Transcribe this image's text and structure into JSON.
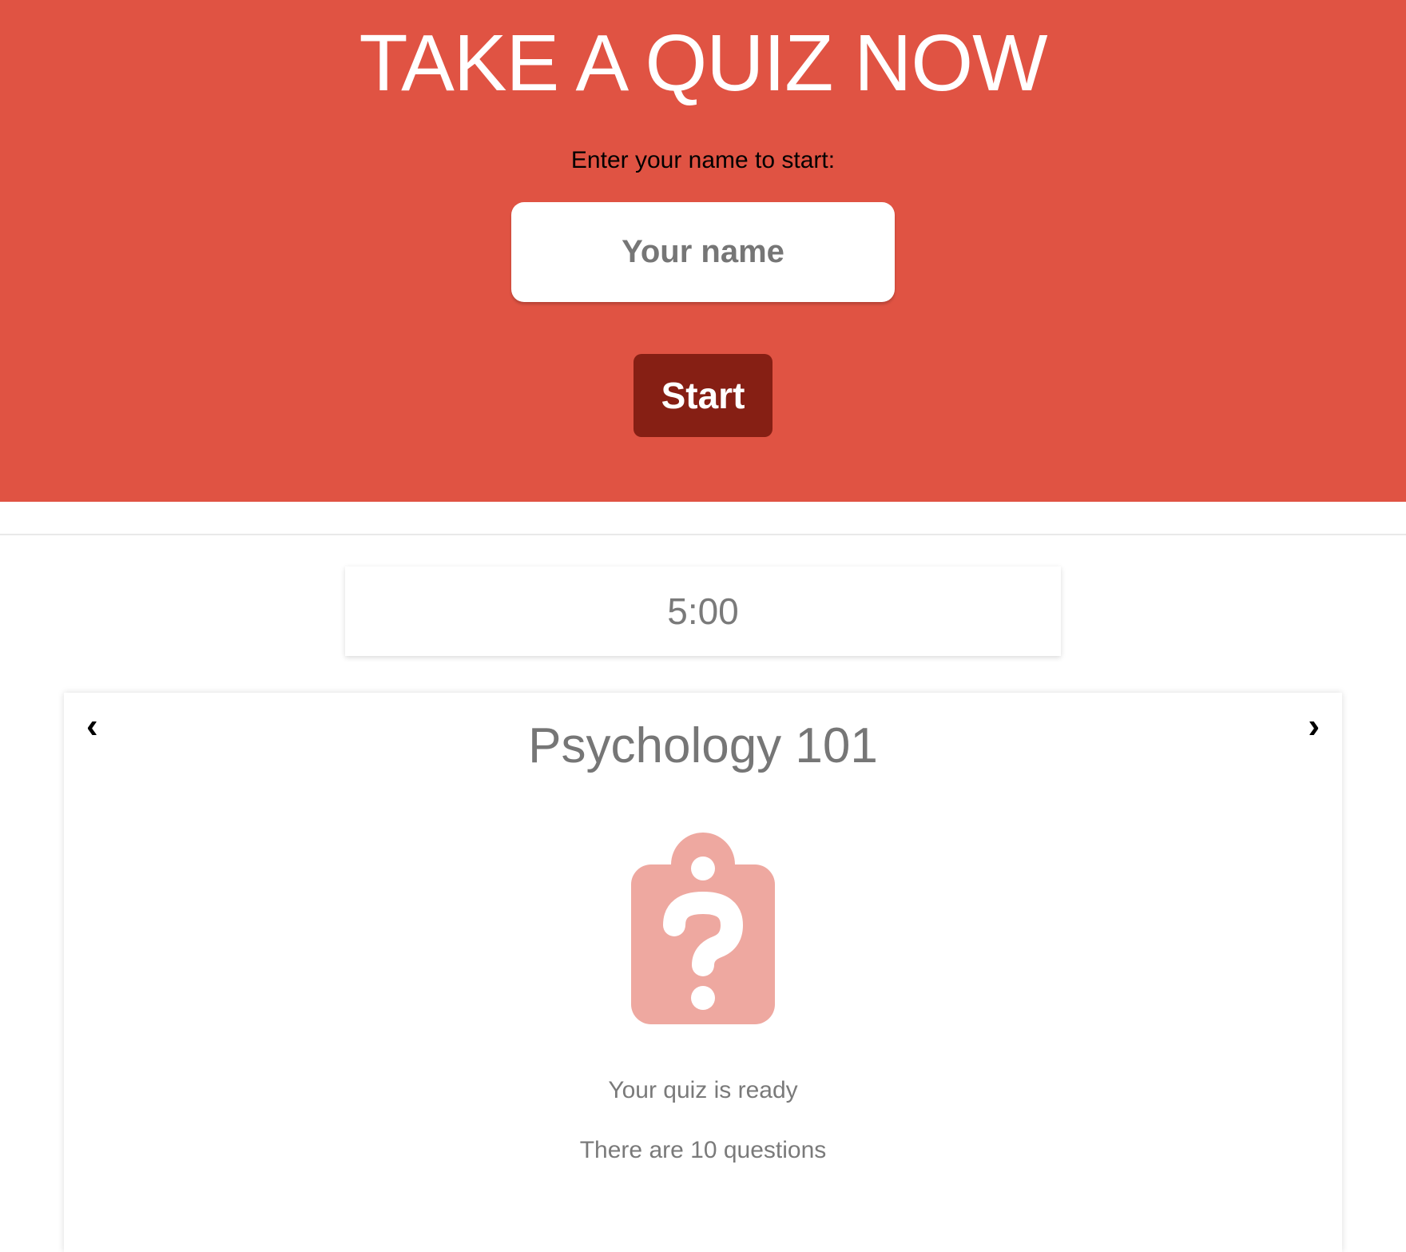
{
  "hero": {
    "title": "TAKE A QUIZ NOW",
    "prompt": "Enter your name to start:",
    "name_placeholder": "Your name",
    "start_label": "Start",
    "background": "#e05343",
    "button_color": "#861f14"
  },
  "timer": {
    "value": "5:00"
  },
  "quiz": {
    "prev_label": "‹",
    "next_label": "›",
    "title": "Psychology 101",
    "icon": "clipboard-question-icon",
    "icon_color": "#eea8a0",
    "ready_text": "Your quiz is ready",
    "count_text": "There are 10 questions"
  }
}
